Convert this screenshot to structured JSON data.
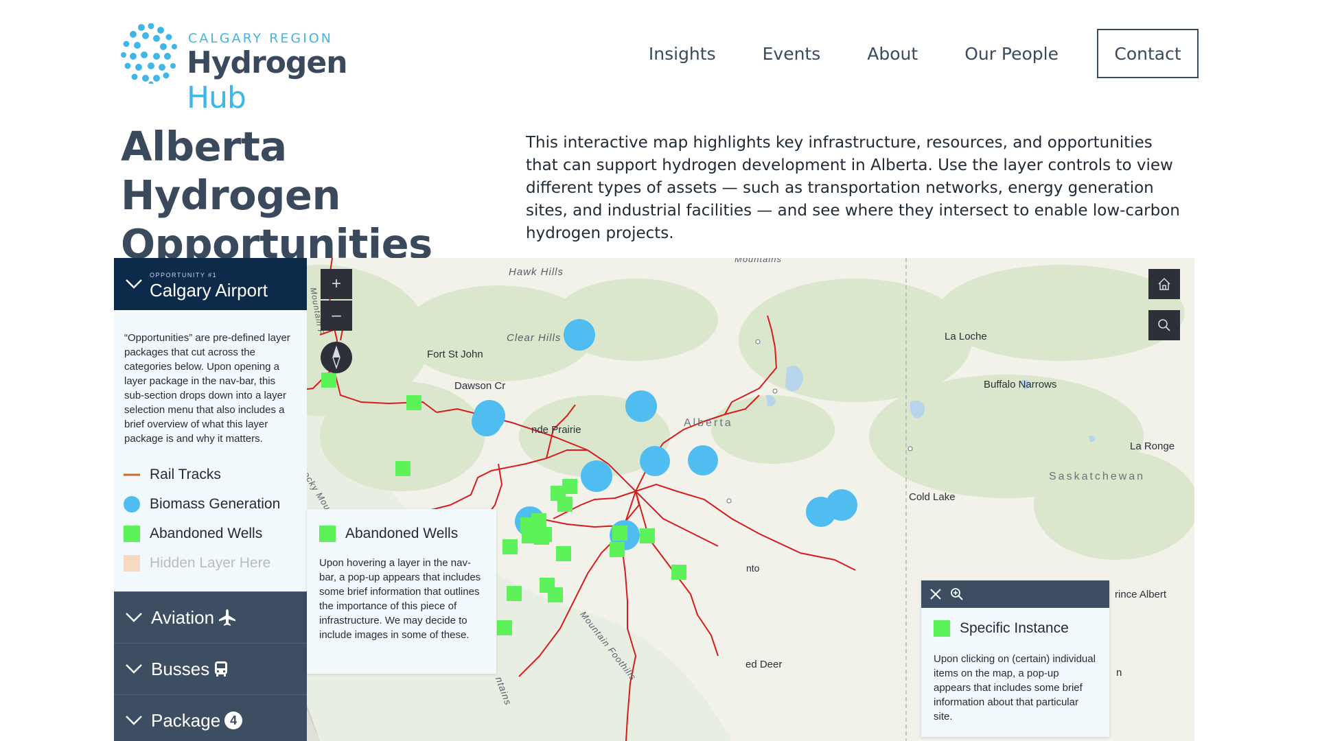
{
  "brand": {
    "region": "CALGARY REGION",
    "name_main": "Hydrogen",
    "name_accent": "Hub",
    "accent_color": "#3fb6e6",
    "text_color": "#3a4a5c"
  },
  "nav": {
    "items": [
      "Insights",
      "Events",
      "About",
      "Our People"
    ],
    "contact": "Contact"
  },
  "page": {
    "title": "Alberta Hydrogen Opportunities Map",
    "intro": "This interactive map highlights key infrastructure, resources, and opportunities that can support hydrogen development in Alberta. Use the layer controls to view different types of assets — such as transportation networks, energy generation sites, and industrial facilities — and see where they intersect to enable low-carbon hydrogen projects."
  },
  "sidebar": {
    "kicker": "OPPORTUNITY #1",
    "title": "Calgary Airport",
    "description": "“Opportunities” are pre-defined layer packages that cut across the categories below. Upon opening a layer package in the nav-bar, this sub-section drops down into a layer selection menu that also includes a brief overview of what this layer package is and why it matters.",
    "legend": [
      {
        "label": "Rail Tracks",
        "type": "line",
        "color": "#d2642a"
      },
      {
        "label": "Biomass Generation",
        "type": "circle",
        "color": "#4fbdf0"
      },
      {
        "label": "Abandoned Wells",
        "type": "square",
        "color": "#5ef25a"
      },
      {
        "label": "Hidden Layer Here",
        "type": "square",
        "color": "#f7d9c2"
      }
    ],
    "categories": [
      {
        "label": "Aviation",
        "icon": "airplane-icon"
      },
      {
        "label": "Busses",
        "icon": "bus-icon"
      },
      {
        "label": "Package",
        "icon": "badge-4",
        "badge": "4"
      }
    ],
    "head_color": "#0e2a4b",
    "category_color": "#3d4e62"
  },
  "map_controls": {
    "zoom_in": "+",
    "zoom_out": "–",
    "home_icon": "home-icon",
    "search_icon": "search-icon",
    "compass_icon": "compass-icon"
  },
  "layer_popup": {
    "title": "Abandoned Wells",
    "body": "Upon hovering a layer in the nav-bar, a pop-up appears that includes some brief information that outlines the importance of this piece of infrastructure. We may decide to include images in some of these."
  },
  "instance_popup": {
    "title": "Specific Instance",
    "body": "Upon clicking on (certain) individual items on the map, a pop-up appears that includes some brief information about that particular site.",
    "close_icon": "close-icon",
    "zoom_icon": "zoom-in-icon"
  },
  "map_labels": {
    "places": [
      "Hawk Hills",
      "Clear Hills",
      "Fort St John",
      "Dawson Cr",
      "nde Prairie",
      "La Loche",
      "Buffalo Narrows",
      "La Ronge",
      "Cold Lake",
      "rince Albert",
      "ed Deer",
      "Mountains",
      "Alberta",
      "Saskatchewan",
      "Rocky Mountain Trench",
      "Mountain Foothills",
      "ntains",
      "Mountain F",
      "n",
      "nto"
    ],
    "hawk_hills": "Hawk Hills",
    "clear_hills": "Clear Hills",
    "fort_st_john": "Fort St John",
    "dawson": "Dawson Cr",
    "grande_prairie": "nde Prairie",
    "la_loche": "La Loche",
    "buffalo_narrows": "Buffalo Narrows",
    "la_ronge": "La Ronge",
    "cold_lake": "Cold Lake",
    "prince_albert": "rince Albert",
    "red_deer": "ed Deer",
    "mountains_top": "Mountains",
    "alberta": "Alberta",
    "saskatchewan": "Saskatchewan",
    "rocky_trench": "Rocky Mountain Trench",
    "foothills": "Mountain Foothills",
    "ntains": "ntains",
    "mountain_f": "Mountain F",
    "edmonton_fragment": "nto",
    "n_fragment": "n"
  }
}
